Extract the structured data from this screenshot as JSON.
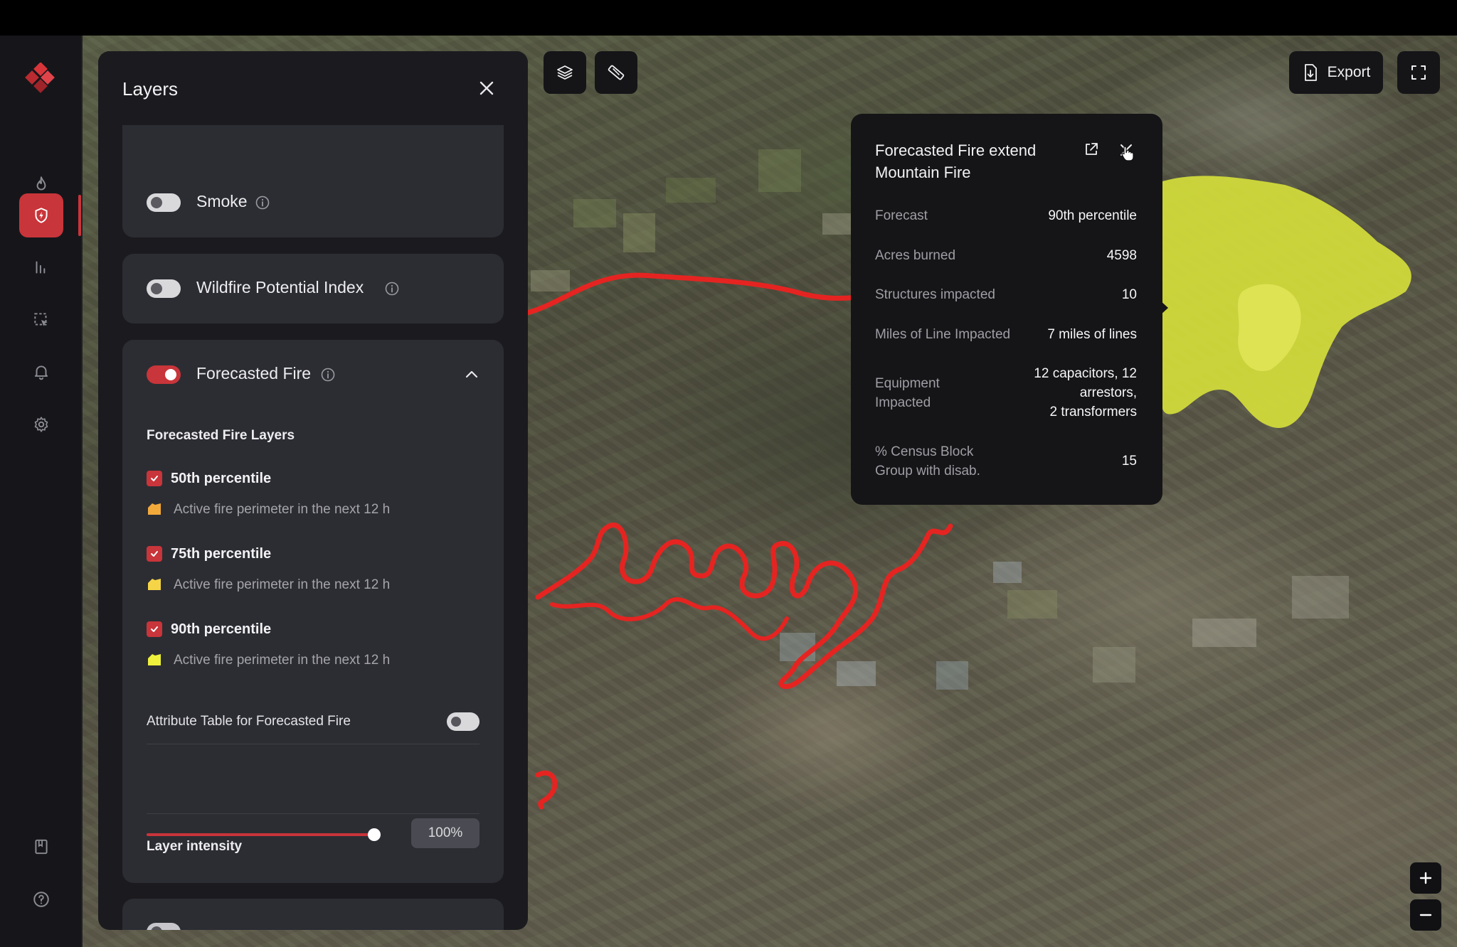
{
  "panel": {
    "title": "Layers",
    "layers": [
      {
        "label": "Smoke",
        "enabled": false
      },
      {
        "label": "Wildfire Potential Index",
        "enabled": false
      },
      {
        "label": "Forecasted Fire",
        "enabled": true
      }
    ],
    "forecasted_fire": {
      "subtitle": "Forecasted Fire Layers",
      "items": [
        {
          "label": "50th percentile",
          "checked": true,
          "legend": "Active fire perimeter in the next 12 h",
          "color": "#f2a93b"
        },
        {
          "label": "75th percentile",
          "checked": true,
          "legend": "Active fire perimeter in the next 12 h",
          "color": "#f5d547"
        },
        {
          "label": "90th percentile",
          "checked": true,
          "legend": "Active fire perimeter in the next 12 h",
          "color": "#eef03c"
        }
      ],
      "attribute_table_label": "Attribute Table for Forecasted Fire",
      "attribute_table_enabled": false,
      "intensity_label": "Layer intensity",
      "intensity_value": "100%",
      "intensity": 1.0
    }
  },
  "map_toolbar": {
    "export_label": "Export",
    "icons": [
      "layers-icon",
      "ruler-icon",
      "export-file-icon",
      "fullscreen-icon"
    ]
  },
  "zoom": {
    "in": "+",
    "out": "−"
  },
  "popup": {
    "title_line1": "Forecasted Fire extend",
    "title_line2": "Mountain Fire",
    "rows": [
      {
        "label": "Forecast",
        "value": "90th percentile"
      },
      {
        "label": "Acres burned",
        "value": "4598"
      },
      {
        "label": "Structures impacted",
        "value": "10"
      },
      {
        "label": "Miles of Line Impacted",
        "value": "7 miles of lines"
      },
      {
        "label_lines": [
          "Equipment",
          "Impacted"
        ],
        "value_lines": [
          "12 capacitors, 12",
          "arrestors,",
          "2 transformers"
        ]
      },
      {
        "label_lines": [
          "% Census Block",
          "Group with disab."
        ],
        "value": "15"
      }
    ]
  },
  "colors": {
    "accent": "#c8353a",
    "fire_perimeter": "#e52421",
    "forecast_area": "#d8e039"
  }
}
